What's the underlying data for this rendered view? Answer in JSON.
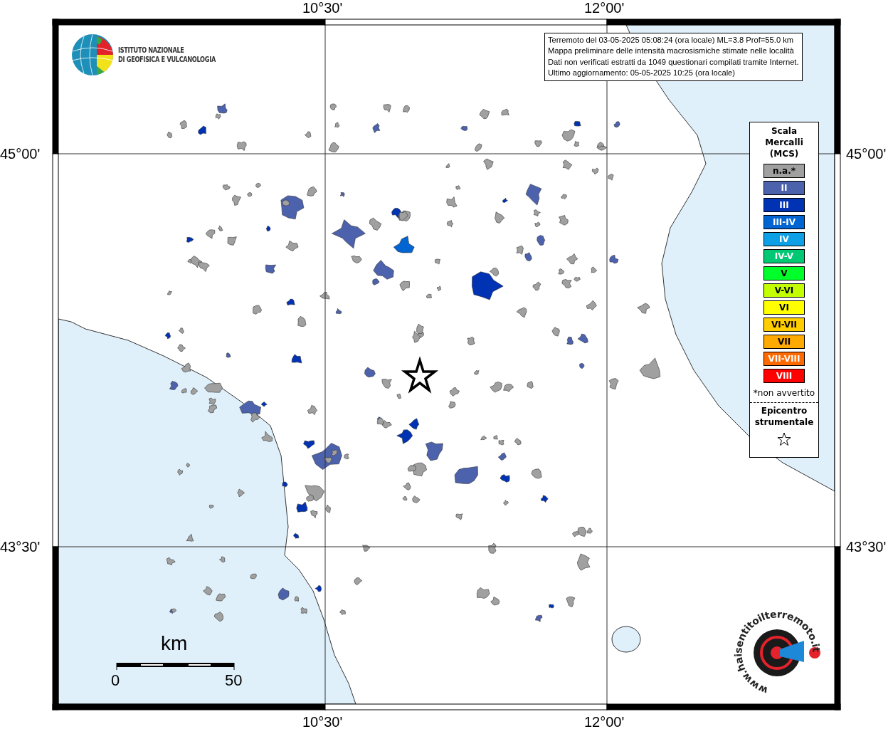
{
  "axis_labels": {
    "top": [
      "10°30'",
      "12°00'"
    ],
    "bottom": [
      "10°30'",
      "12°00'"
    ],
    "left": [
      "45°00'",
      "43°30'"
    ],
    "right": [
      "45°00'",
      "43°30'"
    ]
  },
  "institute_logo": {
    "lines": [
      "ISTITUTO NAZIONALE",
      "DI GEOFISICA E VULCANOLOGIA"
    ]
  },
  "info_box": {
    "lines": [
      "Terremoto del 03-05-2025 05:08:24 (ora locale) ML=3.8 Prof=55.0 km",
      "Mappa preliminare delle intensità macrosismiche stimate nelle località",
      "Dati non verificati estratti da 1049 questionari compilati tramite Internet.",
      "Ultimo aggiornamento: 05-05-2025 10:25 (ora locale)"
    ]
  },
  "legend": {
    "title": [
      "Scala",
      "Mercalli",
      "(MCS)"
    ],
    "items": [
      {
        "label": "n.a.*",
        "color": "#a0a0a0"
      },
      {
        "label": "II",
        "color": "#4c62ad"
      },
      {
        "label": "III",
        "color": "#0032b4"
      },
      {
        "label": "III-IV",
        "color": "#0064d2"
      },
      {
        "label": "IV",
        "color": "#0ea0e6"
      },
      {
        "label": "IV-V",
        "color": "#00c873"
      },
      {
        "label": "V",
        "color": "#00ff2a"
      },
      {
        "label": "V-VI",
        "color": "#c3ff00"
      },
      {
        "label": "VI",
        "color": "#ffff00"
      },
      {
        "label": "VI-VII",
        "color": "#ffcd00"
      },
      {
        "label": "VII",
        "color": "#ffaa00"
      },
      {
        "label": "VII-VIII",
        "color": "#ff6a00"
      },
      {
        "label": "VIII",
        "color": "#ff0000"
      }
    ],
    "footnote": "*non avvertito",
    "epicenter_title": "Epicentro strumentale"
  },
  "scale_bar": {
    "unit": "km",
    "ticks": [
      "0",
      "50"
    ]
  },
  "site_logo": {
    "text": "www.haisentitoilterremoto.it"
  }
}
